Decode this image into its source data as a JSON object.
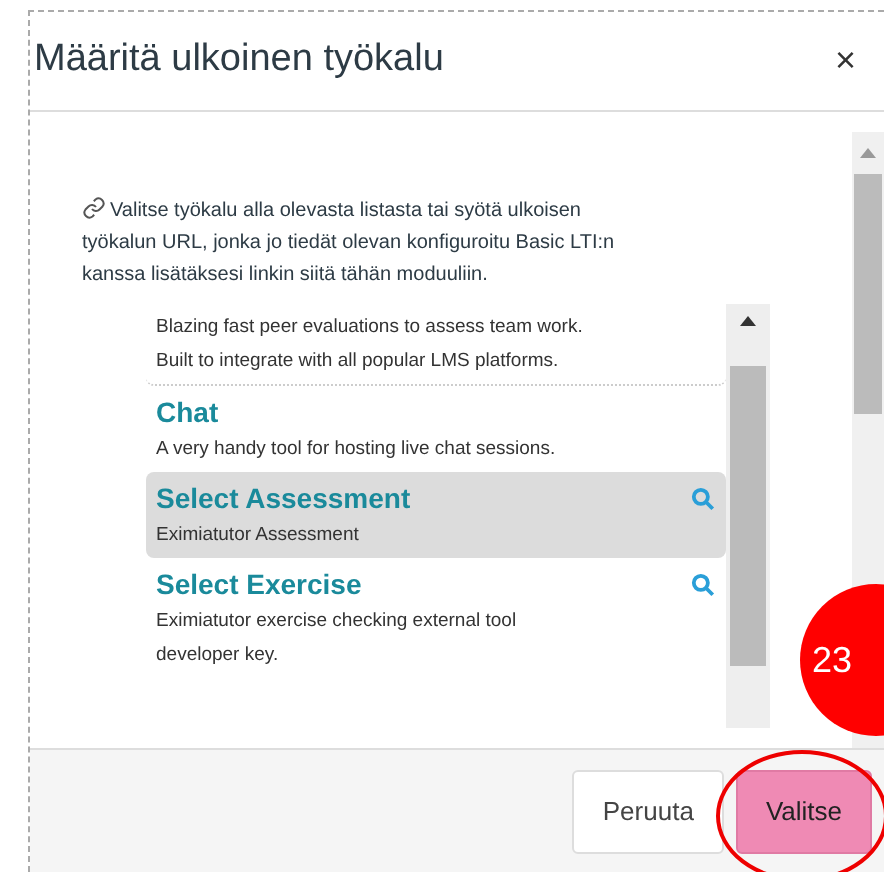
{
  "dialog": {
    "title": "Määritä ulkoinen työkalu",
    "close": "×"
  },
  "intro": "Valitse työkalu alla olevasta listasta tai syötä ulkoisen työkalun URL, jonka jo tiedät olevan konfiguroitu Basic LTI:n kanssa lisätäksesi linkin siitä tähän moduuliin.",
  "tools": [
    {
      "description": "Blazing fast peer evaluations to assess team work. Built to integrate with all popular LMS platforms.",
      "selected": false
    },
    {
      "name": "Chat",
      "description": "A very handy tool for hosting live chat sessions.",
      "selected": false,
      "search_icon": false
    },
    {
      "name": "Select Assessment",
      "description": "Eximiatutor Assessment",
      "selected": true,
      "search_icon": true
    },
    {
      "name": "Select Exercise",
      "description": "Eximiatutor exercise checking external tool developer key.",
      "selected": false,
      "search_icon": true
    }
  ],
  "badge": "23",
  "buttons": [
    {
      "label": "Peruuta",
      "kind": "secondary",
      "highlighted": false
    },
    {
      "label": "Valitse",
      "kind": "primary",
      "highlighted": true
    }
  ]
}
